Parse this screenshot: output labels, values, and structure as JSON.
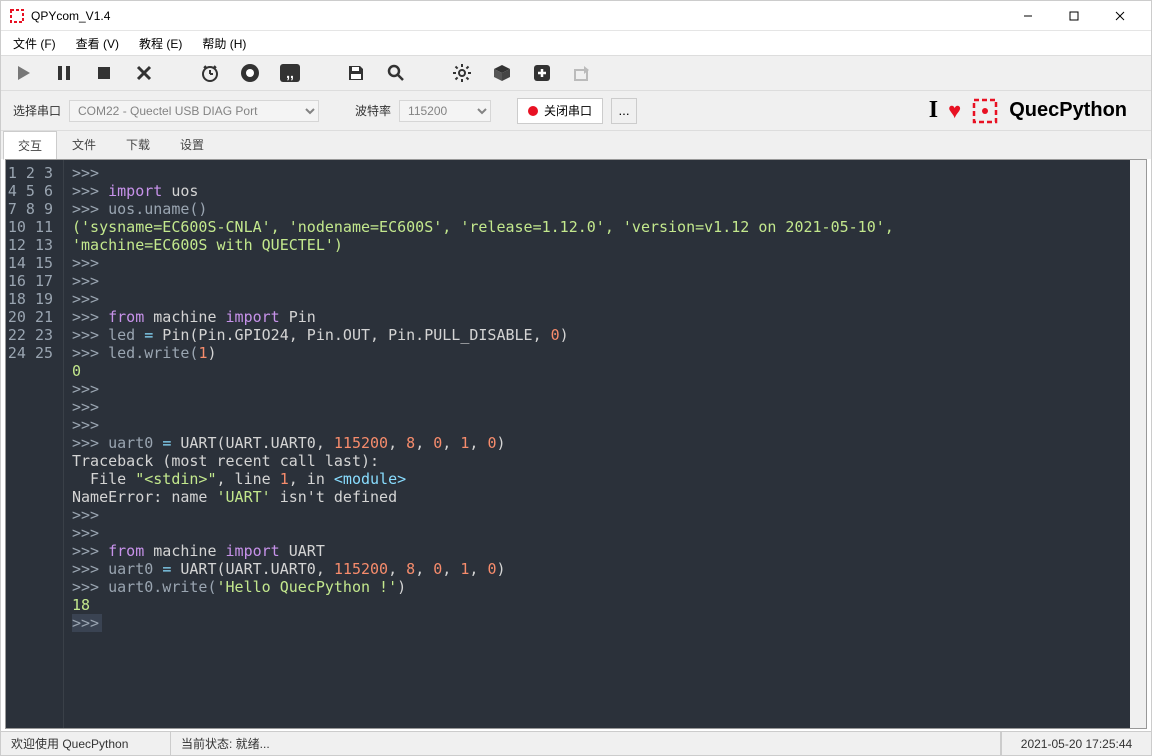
{
  "window": {
    "title": "QPYcom_V1.4"
  },
  "menus": {
    "file": "文件 (F)",
    "view": "查看 (V)",
    "tutorial": "教程 (E)",
    "help": "帮助 (H)"
  },
  "secondbar": {
    "port_label": "选择串口",
    "port_value": "COM22 - Quectel USB DIAG Port",
    "baud_label": "波特率",
    "baud_value": "115200",
    "close_btn": "关闭串口",
    "more": "..."
  },
  "brand": {
    "i": "I",
    "text": "QuecPython"
  },
  "tabs": {
    "t0": "交互",
    "t1": "文件",
    "t2": "下载",
    "t3": "设置"
  },
  "gutter": [
    "1",
    "2",
    "3",
    "4",
    "5",
    "6",
    "7",
    "8",
    "9",
    "10",
    "11",
    "12",
    "13",
    "14",
    "15",
    "16",
    "17",
    "18",
    "19",
    "20",
    "21",
    "22",
    "23",
    "24",
    "25"
  ],
  "code": {
    "l1": ">>>",
    "l2_1": ">>> ",
    "l2_kw": "import",
    "l2_2": " uos",
    "l3": ">>> uos.uname()",
    "l4": "('sysname=EC600S-CNLA', 'nodename=EC600S', 'release=1.12.0', 'version=v1.12 on 2021-05-10',\n'machine=EC600S with QUECTEL')",
    "l5": ">>>",
    "l6": ">>>",
    "l7": ">>>",
    "l8_1": ">>> ",
    "l8_kw1": "from",
    "l8_2": " machine ",
    "l8_kw2": "import",
    "l8_3": " Pin",
    "l9_1": ">>> led ",
    "l9_op": "=",
    "l9_2": " Pin(Pin.GPIO24, Pin.OUT, Pin.PULL_DISABLE, ",
    "l9_n": "0",
    "l9_3": ")",
    "l10_1": ">>> led.write(",
    "l10_n": "1",
    "l10_2": ")",
    "l11": "0",
    "l12": ">>>",
    "l13": ">>>",
    "l14": ">>>",
    "l15_1": ">>> uart0 ",
    "l15_op": "=",
    "l15_2": " UART(UART.UART0, ",
    "l15_n1": "115200",
    "l15_3": ", ",
    "l15_n2": "8",
    "l15_4": ", ",
    "l15_n3": "0",
    "l15_5": ", ",
    "l15_n4": "1",
    "l15_6": ", ",
    "l15_n5": "0",
    "l15_7": ")",
    "l16": "Traceback (most recent call last):",
    "l17_1": "  File ",
    "l17_s": "\"<stdin>\"",
    "l17_2": ", line ",
    "l17_n": "1",
    "l17_3": ", in ",
    "l17_4": "<module>",
    "l18_1": "NameError: name ",
    "l18_s": "'UART'",
    "l18_2": " isn't defined",
    "l19": ">>>",
    "l20": ">>>",
    "l21_1": ">>> ",
    "l21_kw1": "from",
    "l21_2": " machine ",
    "l21_kw2": "import",
    "l21_3": " UART",
    "l22_1": ">>> uart0 ",
    "l22_op": "=",
    "l22_2": " UART(UART.UART0, ",
    "l22_n1": "115200",
    "l22_3": ", ",
    "l22_n2": "8",
    "l22_4": ", ",
    "l22_n3": "0",
    "l22_5": ", ",
    "l22_n4": "1",
    "l22_6": ", ",
    "l22_n5": "0",
    "l22_7": ")",
    "l23_1": ">>> uart0.write(",
    "l23_s": "'Hello QuecPython !'",
    "l23_2": ")",
    "l24": "18",
    "l25": ">>>"
  },
  "status": {
    "welcome": "欢迎使用 QuecPython",
    "state": "当前状态: 就绪...",
    "time": "2021-05-20 17:25:44"
  }
}
